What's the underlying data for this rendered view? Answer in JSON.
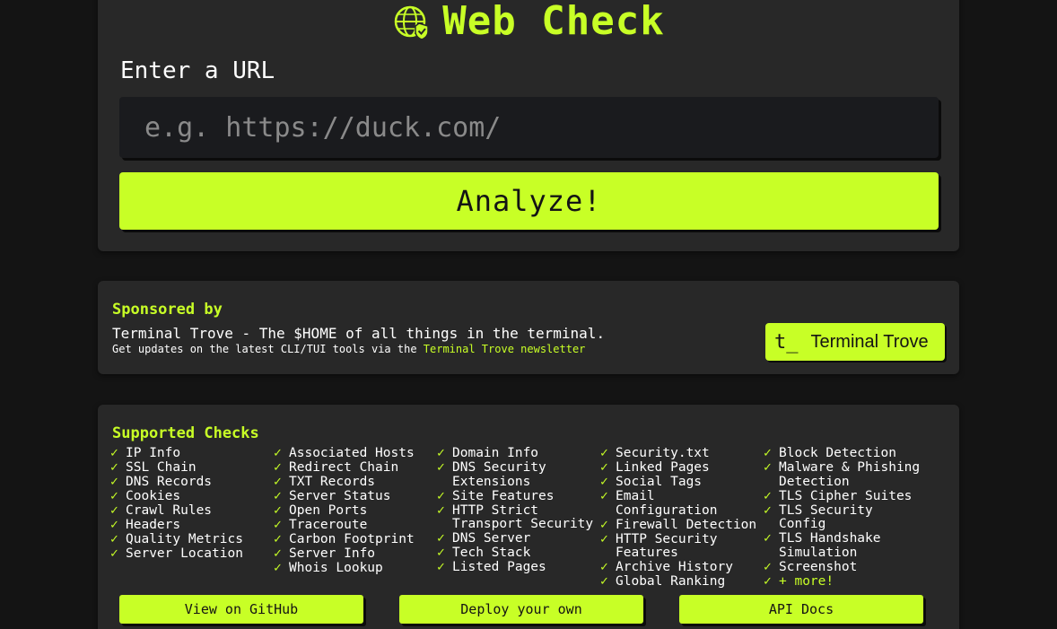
{
  "hero": {
    "title": "Web Check",
    "url_label": "Enter a URL",
    "url_placeholder": "e.g. https://duck.com/",
    "url_value": "",
    "analyze_label": "Analyze!"
  },
  "sponsor": {
    "title": "Sponsored by",
    "tagline": "Terminal Trove - The $HOME of all things in the terminal.",
    "subtext_prefix": "Get updates on the latest CLI/TUI tools via the ",
    "newsletter_link": "Terminal Trove newsletter",
    "button_icon": "t_",
    "button_label": "Terminal Trove"
  },
  "checks": {
    "title": "Supported Checks",
    "tick": "✓",
    "columns": [
      [
        "IP Info",
        "SSL Chain",
        "DNS Records",
        "Cookies",
        "Crawl Rules",
        "Headers",
        "Quality Metrics",
        "Server Location"
      ],
      [
        "Associated Hosts",
        "Redirect Chain",
        "TXT Records",
        "Server Status",
        "Open Ports",
        "Traceroute",
        "Carbon Footprint",
        "Server Info",
        "Whois Lookup"
      ],
      [
        "Domain Info",
        "DNS Security Extensions",
        "Site Features",
        "HTTP Strict Transport Security",
        "DNS Server",
        "Tech Stack",
        "Listed Pages"
      ],
      [
        "Security.txt",
        "Linked Pages",
        "Social Tags",
        "Email Configuration",
        "Firewall Detection",
        "HTTP Security Features",
        "Archive History",
        "Global Ranking"
      ],
      [
        "Block Detection",
        "Malware & Phishing Detection",
        "TLS Cipher Suites",
        "TLS Security Config",
        "TLS Handshake Simulation",
        "Screenshot",
        "+ more!"
      ]
    ],
    "buttons": [
      "View on GitHub",
      "Deploy your own",
      "API Docs"
    ]
  },
  "colors": {
    "accent": "#c8ff26",
    "background": "#141414",
    "card": "#282828",
    "input": "#1a1b1e"
  }
}
